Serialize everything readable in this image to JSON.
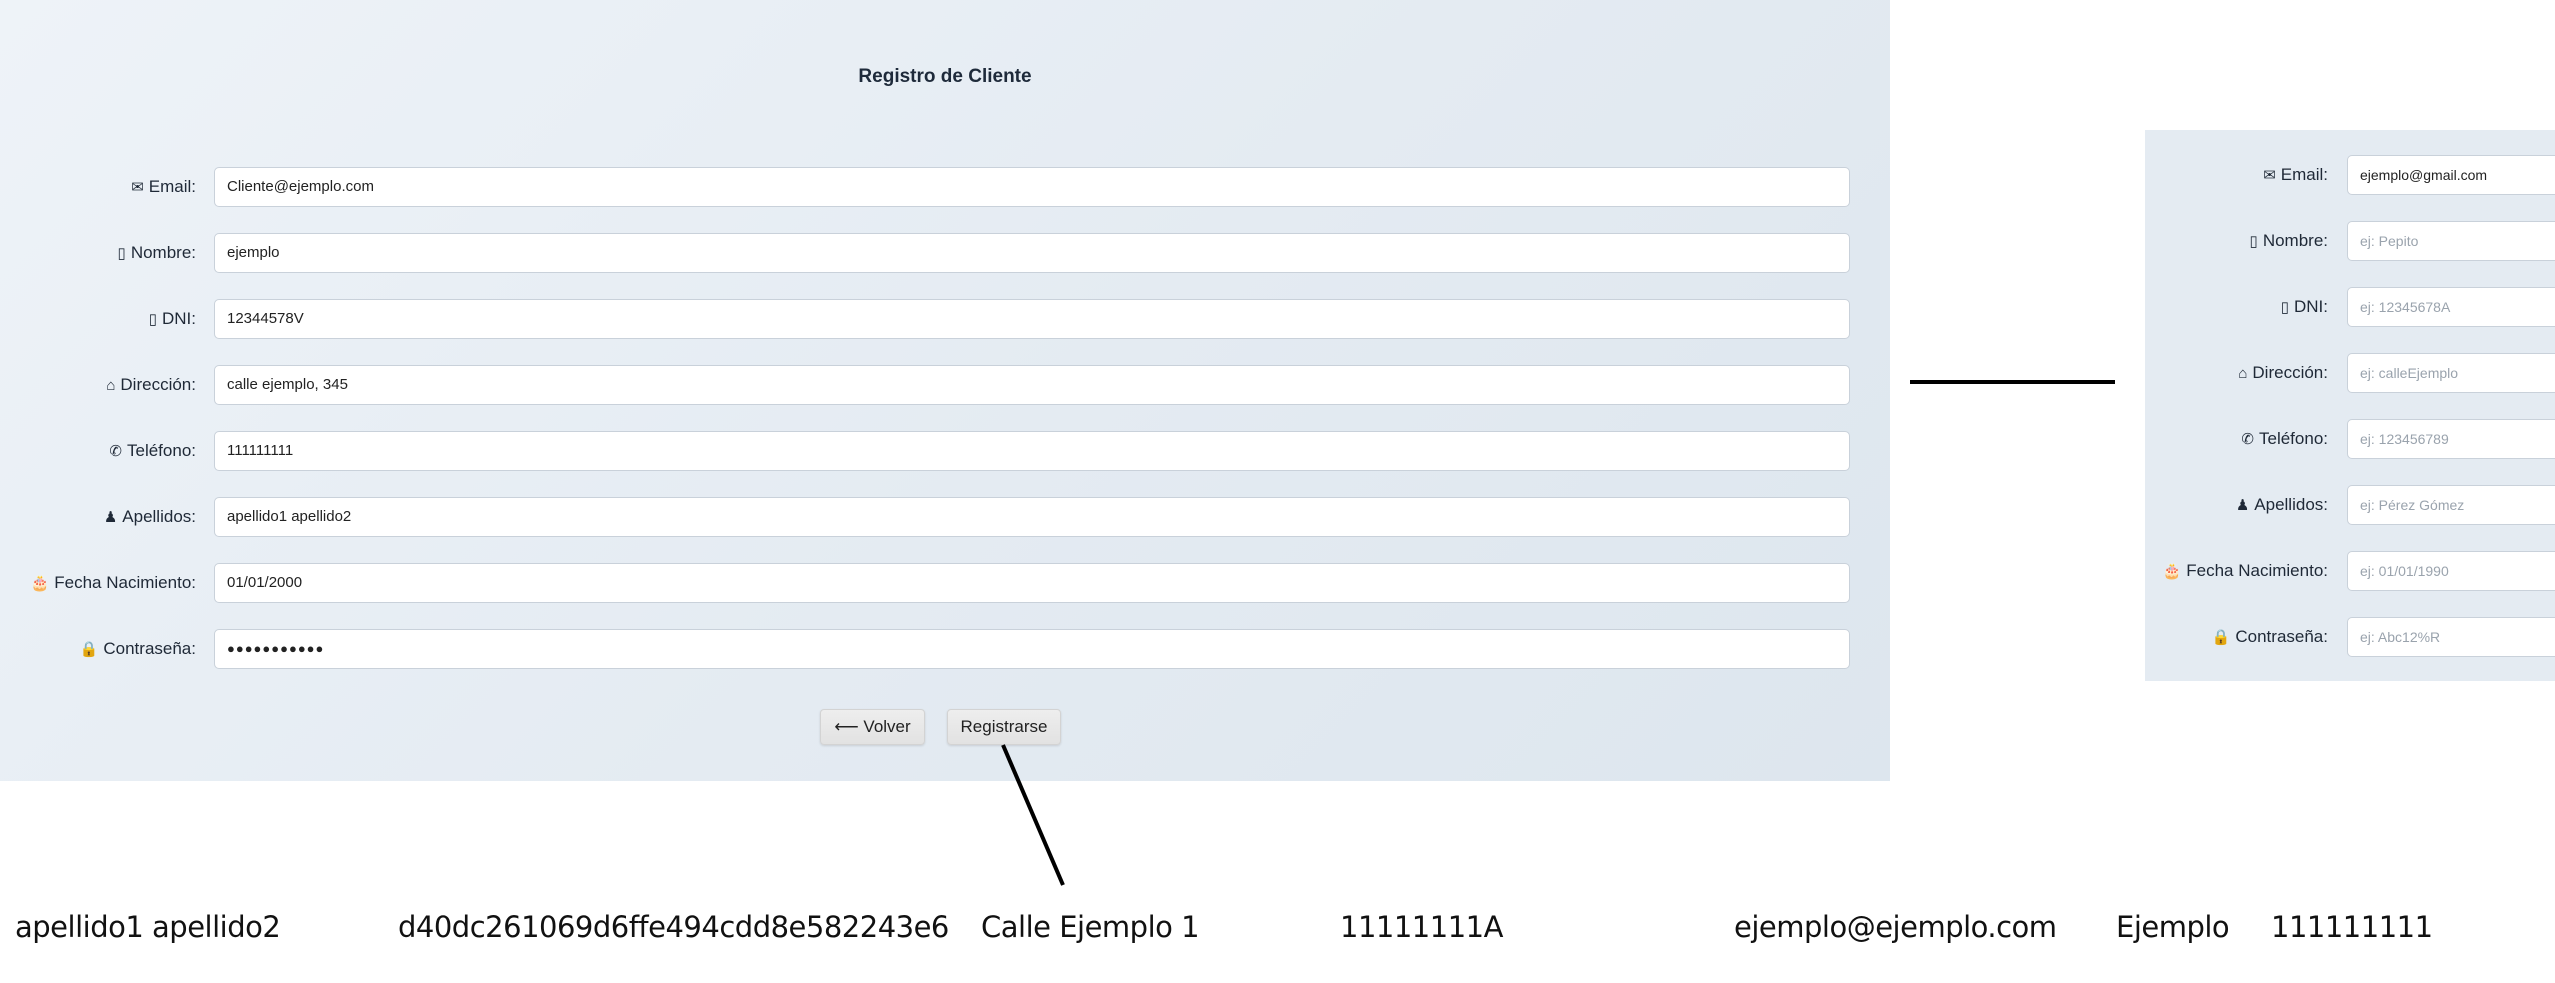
{
  "main_form": {
    "title": "Registro de Cliente",
    "fields": [
      {
        "icon": "✉",
        "icon_name": "envelope-icon",
        "label": "Email:",
        "value": "Cliente@ejemplo.com"
      },
      {
        "icon": "▯",
        "icon_name": "person-card-icon",
        "label": "Nombre:",
        "value": "ejemplo"
      },
      {
        "icon": "▯",
        "icon_name": "id-card-icon",
        "label": "DNI:",
        "value": "12344578V"
      },
      {
        "icon": "⌂",
        "icon_name": "house-icon",
        "label": "Dirección:",
        "value": "calle ejemplo, 345"
      },
      {
        "icon": "✆",
        "icon_name": "phone-icon",
        "label": "Teléfono:",
        "value": "111111111"
      },
      {
        "icon": "♟",
        "icon_name": "person-icon",
        "label": "Apellidos:",
        "value": "apellido1 apellido2"
      },
      {
        "icon": "🎂",
        "icon_name": "cake-icon",
        "label": "Fecha Nacimiento:",
        "value": "01/01/2000"
      },
      {
        "icon": "🔒",
        "icon_name": "lock-icon",
        "label": "Contraseña:",
        "value": "●●●●●●●●●●●"
      }
    ],
    "back_button": "⟵ Volver",
    "submit_button": "Registrarse"
  },
  "side_form": {
    "fields": [
      {
        "icon": "✉",
        "label": "Email:",
        "value": "ejemplo@gmail.com",
        "placeholder": ""
      },
      {
        "icon": "▯",
        "label": "Nombre:",
        "value": "",
        "placeholder": "ej: Pepito"
      },
      {
        "icon": "▯",
        "label": "DNI:",
        "value": "",
        "placeholder": "ej: 12345678A"
      },
      {
        "icon": "⌂",
        "label": "Dirección:",
        "value": "",
        "placeholder": "ej: calleEjemplo"
      },
      {
        "icon": "✆",
        "label": "Teléfono:",
        "value": "",
        "placeholder": "ej: 123456789"
      },
      {
        "icon": "♟",
        "label": "Apellidos:",
        "value": "",
        "placeholder": "ej: Pérez Gómez"
      },
      {
        "icon": "🎂",
        "label": "Fecha Nacimiento:",
        "value": "",
        "placeholder": "ej: 01/01/1990"
      },
      {
        "icon": "🔒",
        "label": "Contraseña:",
        "value": "",
        "placeholder": "ej: Abc12%R"
      }
    ]
  },
  "db_row": {
    "apellidos": "apellido1 apellido2",
    "hash": "d40dc261069d6ffe494cdd8e582243e6",
    "direccion": "Calle Ejemplo 1",
    "dni": "11111111A",
    "email": "ejemplo@ejemplo.com",
    "nombre": "Ejemplo",
    "telefono": "111111111"
  }
}
